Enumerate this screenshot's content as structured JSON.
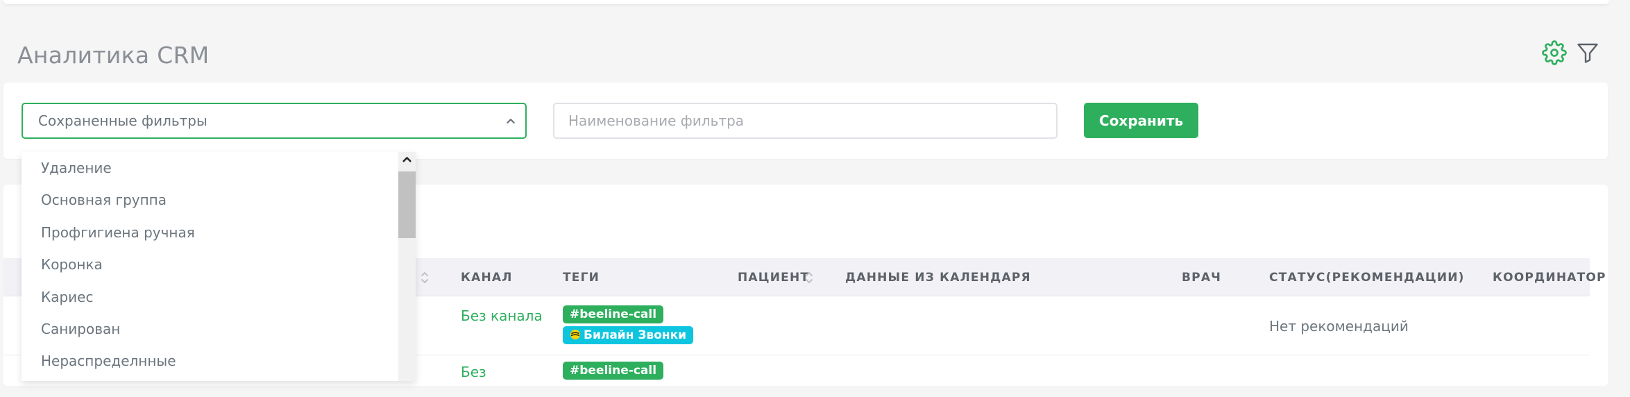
{
  "page": {
    "title": "Аналитика CRM"
  },
  "header_icons": {
    "settings": "gear-icon",
    "filter": "funnel-icon",
    "accent_color": "#2eaf5e"
  },
  "filters": {
    "saved_filters_select": {
      "value": "Сохраненные фильтры"
    },
    "filter_name": {
      "placeholder": "Наименование фильтра",
      "value": ""
    },
    "save_label": "Сохранить"
  },
  "saved_filters_options": [
    "Удаление",
    "Основная группа",
    "Профгигиена ручная",
    "Коронка",
    "Кариес",
    "Санирован",
    "Нераспределнные"
  ],
  "table": {
    "columns": [
      "КАНАЛ",
      "ТЕГИ",
      "ПАЦИЕНТ",
      "ДАННЫЕ ИЗ КАЛЕНДАРЯ",
      "ВРАЧ",
      "СТАТУС(РЕКОМЕНДАЦИИ)",
      "КООРДИНАТОР"
    ],
    "rows": [
      {
        "channel": "Без канала",
        "tags": [
          {
            "label": "#beeline-call",
            "color": "#2eaf5e"
          },
          {
            "label": "Билайн Звонки",
            "color": "#0ec5e0",
            "icon": "beeline-logo-icon"
          }
        ],
        "patient": "",
        "calendar": "",
        "doctor": "",
        "status": "Нет рекомендаций",
        "coordinator": ""
      },
      {
        "channel": "Без",
        "tags": [
          {
            "label": "#beeline-call",
            "color": "#2eaf5e"
          }
        ]
      }
    ]
  }
}
